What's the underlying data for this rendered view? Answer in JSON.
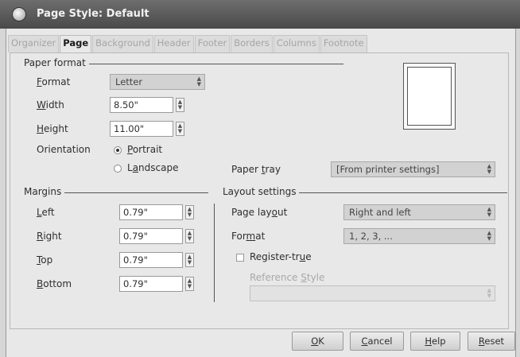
{
  "window": {
    "title": "Page Style: Default"
  },
  "tabs": [
    {
      "label": "Organizer",
      "active": false
    },
    {
      "label": "Page",
      "active": true
    },
    {
      "label": "Background",
      "active": false
    },
    {
      "label": "Header",
      "active": false
    },
    {
      "label": "Footer",
      "active": false
    },
    {
      "label": "Borders",
      "active": false
    },
    {
      "label": "Columns",
      "active": false
    },
    {
      "label": "Footnote",
      "active": false
    }
  ],
  "paper_format": {
    "heading": "Paper format",
    "format_label": "Format",
    "format_value": "Letter",
    "width_label": "Width",
    "width_value": "8.50\"",
    "height_label": "Height",
    "height_value": "11.00\"",
    "orientation_label": "Orientation",
    "portrait_label": "Portrait",
    "landscape_label": "Landscape",
    "orientation_selected": "Portrait",
    "paper_tray_label": "Paper tray",
    "paper_tray_value": "[From printer settings]"
  },
  "margins": {
    "heading": "Margins",
    "left_label": "Left",
    "left_value": "0.79\"",
    "right_label": "Right",
    "right_value": "0.79\"",
    "top_label": "Top",
    "top_value": "0.79\"",
    "bottom_label": "Bottom",
    "bottom_value": "0.79\""
  },
  "layout_settings": {
    "heading": "Layout settings",
    "page_layout_label": "Page layout",
    "page_layout_value": "Right and left",
    "format_label": "Format",
    "format_value": "1, 2, 3, ...",
    "register_true_label": "Register-true",
    "register_true_checked": false,
    "reference_style_label": "Reference Style",
    "reference_style_value": ""
  },
  "buttons": {
    "ok": "OK",
    "cancel": "Cancel",
    "help": "Help",
    "reset": "Reset"
  },
  "icons": {
    "title": "app-icon",
    "spin": "spin-arrows-icon",
    "combo": "combo-arrows-icon"
  }
}
